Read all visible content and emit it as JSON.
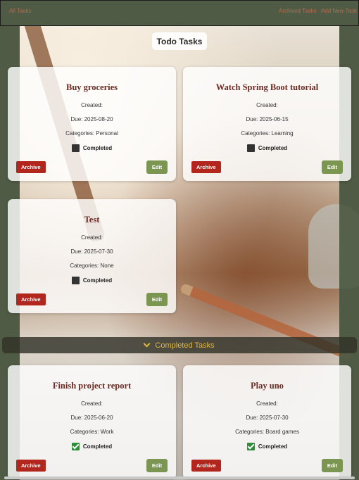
{
  "nav": {
    "all_tasks": "All Tasks",
    "archived_tasks": "Archived Tasks",
    "add_new_task": "Add New Task"
  },
  "page": {
    "title": "Todo Tasks"
  },
  "todo_tasks": [
    {
      "title": "Buy groceries",
      "created": "Created:",
      "due": "Due: 2025-08-20",
      "categories": "Categories: Personal",
      "status": "Completed",
      "archive_label": "Archive",
      "edit_label": "Edit"
    },
    {
      "title": "Watch Spring Boot tutorial",
      "created": "Created:",
      "due": "Due: 2025-06-15",
      "categories": "Categories: Learning",
      "status": "Completed",
      "archive_label": "Archive",
      "edit_label": "Edit"
    },
    {
      "title": "Test",
      "created": "Created:",
      "due": "Due: 2025-07-30",
      "categories": "Categories: None",
      "status": "Completed",
      "archive_label": "Archive",
      "edit_label": "Edit"
    }
  ],
  "completed_section": {
    "label": "Completed Tasks"
  },
  "completed_tasks": [
    {
      "title": "Finish project report",
      "created": "Created:",
      "due": "Due: 2025-06-20",
      "categories": "Categories: Work",
      "status": "Completed",
      "archive_label": "Archive",
      "edit_label": "Edit"
    },
    {
      "title": "Play uno",
      "created": "Created:",
      "due": "Due: 2025-07-30",
      "categories": "Categories: Board games",
      "status": "Completed",
      "archive_label": "Archive",
      "edit_label": "Edit"
    }
  ],
  "colors": {
    "archive_button": "#b3261e",
    "edit_button": "#7a9650",
    "title_text": "#6b2a22",
    "nav_link": "#b96b4a",
    "completed_header": "#e0b83c",
    "checkbox_checked": "#2f8d37"
  }
}
